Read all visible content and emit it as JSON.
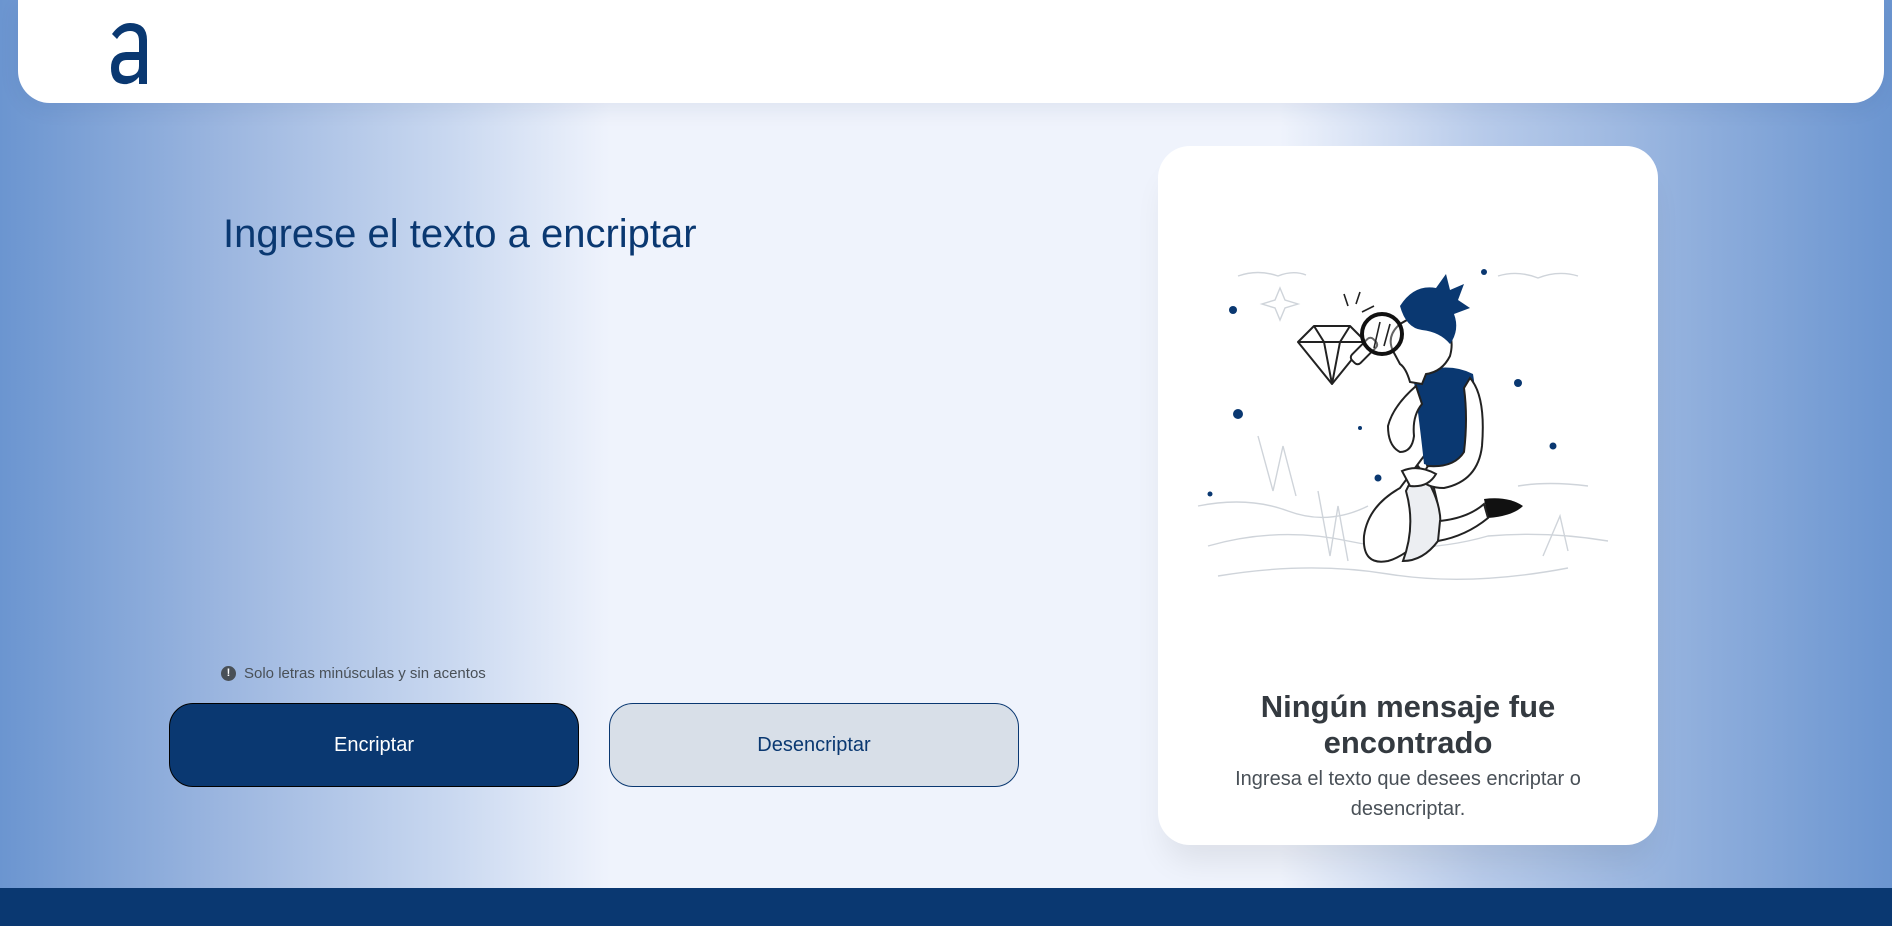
{
  "header": {
    "logo_icon": "alura-a-logo-icon"
  },
  "main": {
    "input": {
      "placeholder": "Ingrese el texto a encriptar",
      "value": ""
    },
    "hint": {
      "icon": "info-icon",
      "glyph": "!",
      "text": "Solo letras minúsculas y sin acentos"
    },
    "buttons": {
      "encrypt_label": "Encriptar",
      "decrypt_label": "Desencriptar"
    }
  },
  "output": {
    "illustration": "person-with-magnifier-illustration",
    "title": "Ningún mensaje fue encontrado",
    "subtitle": "Ingresa el texto que desees encriptar o desencriptar."
  },
  "colors": {
    "primary": "#0a3871",
    "secondary_button": "#d8dfe8",
    "text_dark": "#343a40",
    "text_muted": "#495057",
    "background_light": "#eff3fc"
  }
}
